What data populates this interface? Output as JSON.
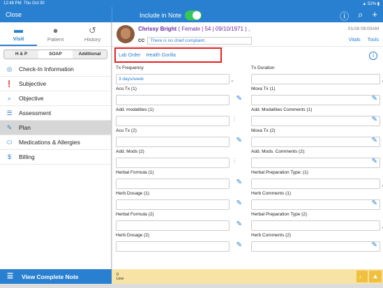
{
  "status": {
    "time": "12:48 PM",
    "date": "Thu Oct 30",
    "battery": "52%"
  },
  "topbar": {
    "close_label": "Close",
    "include_label": "Include in Note"
  },
  "sidebar": {
    "tabs": [
      {
        "label": "Visit"
      },
      {
        "label": "Patient"
      },
      {
        "label": "History"
      }
    ],
    "segments": [
      "H & P",
      "SOAP",
      "Additional"
    ],
    "items": [
      {
        "label": "Check-In Information"
      },
      {
        "label": "Subjective"
      },
      {
        "label": "Objective"
      },
      {
        "label": "Assessment"
      },
      {
        "label": "Plan"
      },
      {
        "label": "Medications & Allergies"
      },
      {
        "label": "Billing"
      }
    ],
    "view_note_label": "View Complete Note"
  },
  "patient": {
    "name": "Chrissy Bright",
    "info": "( Female | 54 | 09/10/1971 ) ,",
    "datetime": "01/26 09:00AM",
    "cc_label": "CC",
    "cc_text": "There is no chief complaint.",
    "vitals_label": "Vitals",
    "tools_label": "Tools"
  },
  "links": {
    "lab_order": "Lab Order",
    "health_gorilla": "Health Gorilla"
  },
  "form": {
    "tx_frequency": {
      "label": "Tx Frequency",
      "value": "3 days/week"
    },
    "tx_duration": {
      "label": "Tx Duration",
      "value": ""
    },
    "acu_tx_1": {
      "label": "Acu Tx (1)"
    },
    "moxa_tx_1": {
      "label": "Moxa Tx (1)"
    },
    "add_modalities_1": {
      "label": "Add. modalities (1)"
    },
    "add_modalities_comments_1": {
      "label": "Add. Modalities Comments (1)"
    },
    "acu_tx_2": {
      "label": "Acu Tx (2)"
    },
    "moxa_tx_2": {
      "label": "Moxa Tx (2)"
    },
    "add_mods_2": {
      "label": "Add. Mods (2)"
    },
    "add_mods_comments_2": {
      "label": "Add. Mods. Comments (2):"
    },
    "herbal_formula_1": {
      "label": "Herbal Formula (1)"
    },
    "herbal_prep_type_1": {
      "label": "Herbal Preparation Type: (1)"
    },
    "herb_dosage_1": {
      "label": "Herb Dosage (1)"
    },
    "herb_comments_1": {
      "label": "Herb Comments (1)"
    },
    "herbal_formula_2": {
      "label": "Herbal Formula (2)"
    },
    "herbal_prep_type_2": {
      "label": "Herbal Preparation Type (2)"
    },
    "herb_dosage_2": {
      "label": "Herb Dosage (2)"
    },
    "herb_comments_2": {
      "label": "Herb Comments (2)"
    }
  },
  "bottombar": {
    "count": "0",
    "unit": "Line"
  }
}
